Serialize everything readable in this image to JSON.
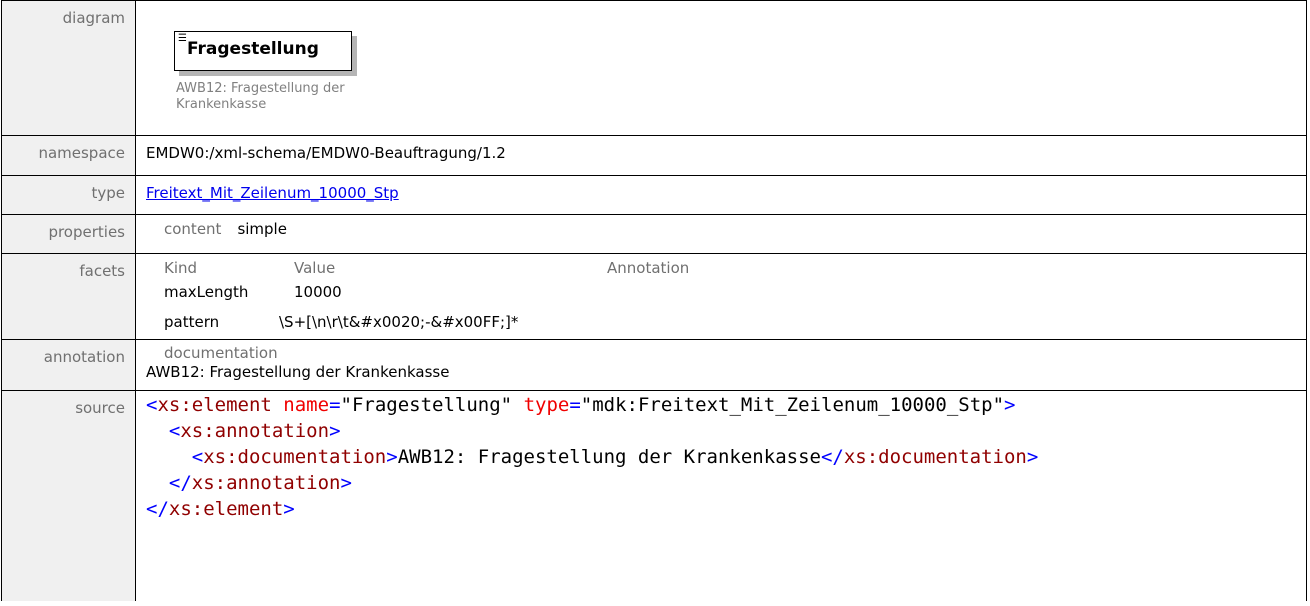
{
  "labels": {
    "diagram": "diagram",
    "namespace": "namespace",
    "type": "type",
    "properties": "properties",
    "facets": "facets",
    "annotation": "annotation",
    "source": "source"
  },
  "diagram": {
    "element_name": "Fragestellung",
    "documentation": "AWB12: Fragestellung der Krankenkasse"
  },
  "namespace": "EMDW0:/xml-schema/EMDW0-Beauftragung/1.2",
  "type": "Freitext_Mit_Zeilenum_10000_Stp",
  "properties": {
    "key": "content",
    "value": "simple"
  },
  "facets": {
    "headers": [
      "Kind",
      "Value",
      "Annotation"
    ],
    "rows": [
      {
        "kind": "maxLength",
        "value": "10000",
        "annotation": ""
      },
      {
        "kind": "pattern",
        "value": "\\S+[\\n\\r\\t&#x0020;-&#x00FF;]*",
        "annotation": ""
      }
    ]
  },
  "annotation": {
    "heading": "documentation",
    "text": "AWB12: Fragestellung der Krankenkasse"
  },
  "source": {
    "open_tag": "xs:element",
    "attr1_name": "name",
    "attr1_value": "\"Fragestellung\"",
    "attr2_name": "type",
    "attr2_value": "\"mdk:Freitext_Mit_Zeilenum_10000_Stp\"",
    "annotation_tag": "xs:annotation",
    "documentation_tag": "xs:documentation",
    "documentation_text": "AWB12: Fragestellung der Krankenkasse"
  },
  "colors": {
    "label_bg": "#f0f0f0",
    "link": "#0000ee",
    "xml_tag": "#900000",
    "xml_attr": "#f00000",
    "xml_bracket": "#0000ff"
  }
}
